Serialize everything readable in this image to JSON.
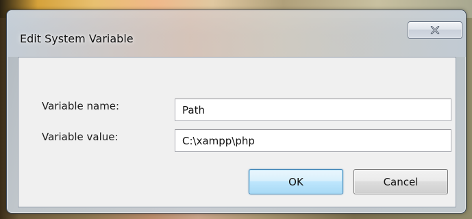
{
  "dialog": {
    "title": "Edit System Variable",
    "close_icon": "close-x-icon"
  },
  "form": {
    "variable_name_label": "Variable name:",
    "variable_name_value": "Path",
    "variable_value_label": "Variable value:",
    "variable_value_value": "C:\\xampp\\php"
  },
  "buttons": {
    "ok_label": "OK",
    "cancel_label": "Cancel"
  },
  "colors": {
    "ok_border": "#3c7fb1",
    "dialog_face": "#f0f0f0"
  }
}
